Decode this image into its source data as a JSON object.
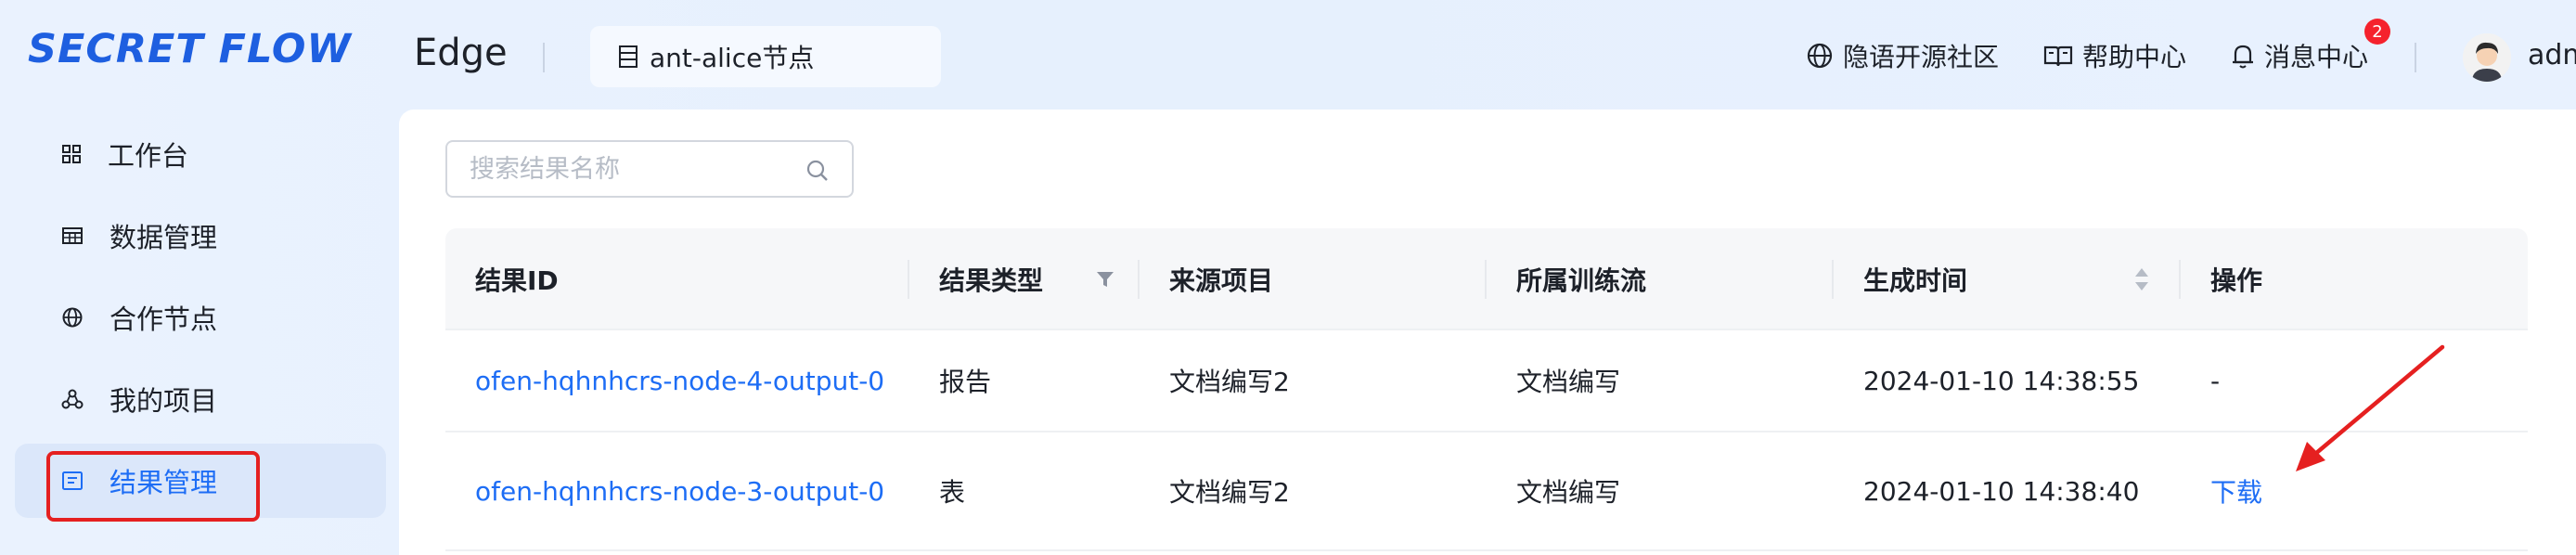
{
  "header": {
    "logo": "SECRET FLOW",
    "product": "Edge",
    "node_selector": "ant-alice节点",
    "nav": [
      {
        "label": "隐语开源社区",
        "icon": "globe-icon"
      },
      {
        "label": "帮助中心",
        "icon": "book-icon"
      },
      {
        "label": "消息中心",
        "icon": "bell-icon"
      }
    ],
    "message_badge": "2",
    "username": "adm"
  },
  "sidebar": {
    "items": [
      {
        "label": "工作台",
        "icon": "grid-icon"
      },
      {
        "label": "数据管理",
        "icon": "table-icon"
      },
      {
        "label": "合作节点",
        "icon": "globe-icon"
      },
      {
        "label": "我的项目",
        "icon": "project-icon"
      },
      {
        "label": "结果管理",
        "icon": "result-icon",
        "active": true
      }
    ]
  },
  "search": {
    "placeholder": "搜索结果名称"
  },
  "table": {
    "columns": [
      "结果ID",
      "结果类型",
      "来源项目",
      "所属训练流",
      "生成时间",
      "操作"
    ],
    "rows": [
      {
        "id": "ofen-hqhnhcrs-node-4-output-0",
        "type": "报告",
        "project": "文档编写2",
        "flow": "文档编写",
        "time": "2024-01-10 14:38:55",
        "action": "-"
      },
      {
        "id": "ofen-hqhnhcrs-node-3-output-0",
        "type": "表",
        "project": "文档编写2",
        "flow": "文档编写",
        "time": "2024-01-10 14:38:40",
        "action": "下载"
      }
    ]
  },
  "colors": {
    "accent": "#1d6df5",
    "highlight": "#e52020",
    "badge": "#f5222d"
  }
}
